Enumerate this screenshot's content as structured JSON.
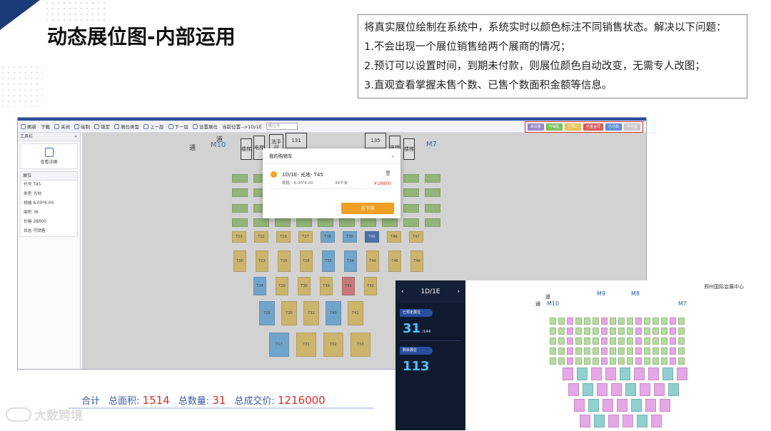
{
  "title": "动态展位图-内部运用",
  "description": {
    "lines": [
      "将真实展位绘制在系统中，系统实时以颜色标注不同销售状态。解决以下问题：",
      "1.不会出现一个展位销售给两个展商的情况；",
      "2.预订可以设置时间，到期未付款，则展位颜色自动改变，无需专人改图；",
      "3.直观查看掌握未售个数、已售个数面积金额等信息。"
    ]
  },
  "app": {
    "toolbar": {
      "items": [
        "刷新",
        "下载",
        "关闭",
        "绘制",
        "锁定",
        "展位类型",
        "上一层",
        "下一层",
        "设置展位"
      ],
      "location_label": "当前位置-->1D/1E",
      "search_placeholder": "展位号"
    },
    "status_legend": [
      {
        "label": "未设置",
        "color": "#9a86c8"
      },
      {
        "label": "可销售",
        "color": "#7cbf5a"
      },
      {
        "label": "已预订",
        "color": "#e8c050"
      },
      {
        "label": "已签合同",
        "color": "#d85a5a"
      },
      {
        "label": "已付款",
        "color": "#5a8fd8"
      },
      {
        "label": "不可售",
        "color": "#c9c9c9"
      }
    ],
    "workbar": {
      "header": "工具栏",
      "collapse_icon": "«",
      "detail_button": "查看详细",
      "section_title": "展位",
      "fields": [
        {
          "label": "代号",
          "value": "T45"
        },
        {
          "label": "类型",
          "value": "光地"
        },
        {
          "label": "规格",
          "value": "6.00*6.00"
        },
        {
          "label": "面积",
          "value": "36"
        },
        {
          "label": "价格",
          "value": "28800"
        },
        {
          "label": "状态",
          "value": "可销售"
        }
      ]
    },
    "map_labels": {
      "m10": "M10",
      "m7": "M7",
      "tong": "通",
      "dao": "道",
      "hall_131": "131",
      "hall_135": "135",
      "elevator": "电梯",
      "stairs": "楼梯",
      "wash": "洗手间"
    },
    "booths": {
      "row_a": [
        "T21",
        "T22",
        "T26",
        "T27",
        "T38",
        "T33",
        "T45",
        "T46",
        "T47"
      ],
      "row_b": [
        "T30",
        "T23",
        "T25",
        "T28",
        "T35",
        "T34",
        "T44",
        "T48",
        "T49"
      ],
      "row_c": [
        "T24",
        "T29",
        "T36",
        "T39",
        "T41",
        "T42"
      ],
      "row_d": [
        "T18",
        "T30",
        "T31",
        "T40",
        "T42"
      ],
      "row_e": [
        "T17",
        "T31",
        "T32",
        "T50"
      ]
    },
    "cart": {
      "title": "我的购物车",
      "close": "×",
      "item_name": "1D/1E- 光地- T45",
      "item_spec": "规格：6.00*6.00",
      "item_area": "36平米",
      "item_price": "￥28800",
      "order_button": "去下单"
    }
  },
  "summary": {
    "label": "合计",
    "area_label": "总面积:",
    "area_value": "1514",
    "count_label": "总数量:",
    "count_value": "31",
    "amount_label": "总成交价:",
    "amount_value": "1216000"
  },
  "logo": {
    "text": "大数跨境"
  },
  "dashboard": {
    "hall": "1D/1E",
    "sold_label": "已预定展位",
    "sold_value": "31",
    "sold_total": "/144",
    "remain_label": "剩余展位",
    "remain_value": "113"
  },
  "light_map": {
    "venue": "郑州国际会展中心",
    "labels": {
      "m9": "M9",
      "m8": "M8",
      "m7": "M7",
      "m10": "M10",
      "tong": "通",
      "dao": "道"
    }
  }
}
